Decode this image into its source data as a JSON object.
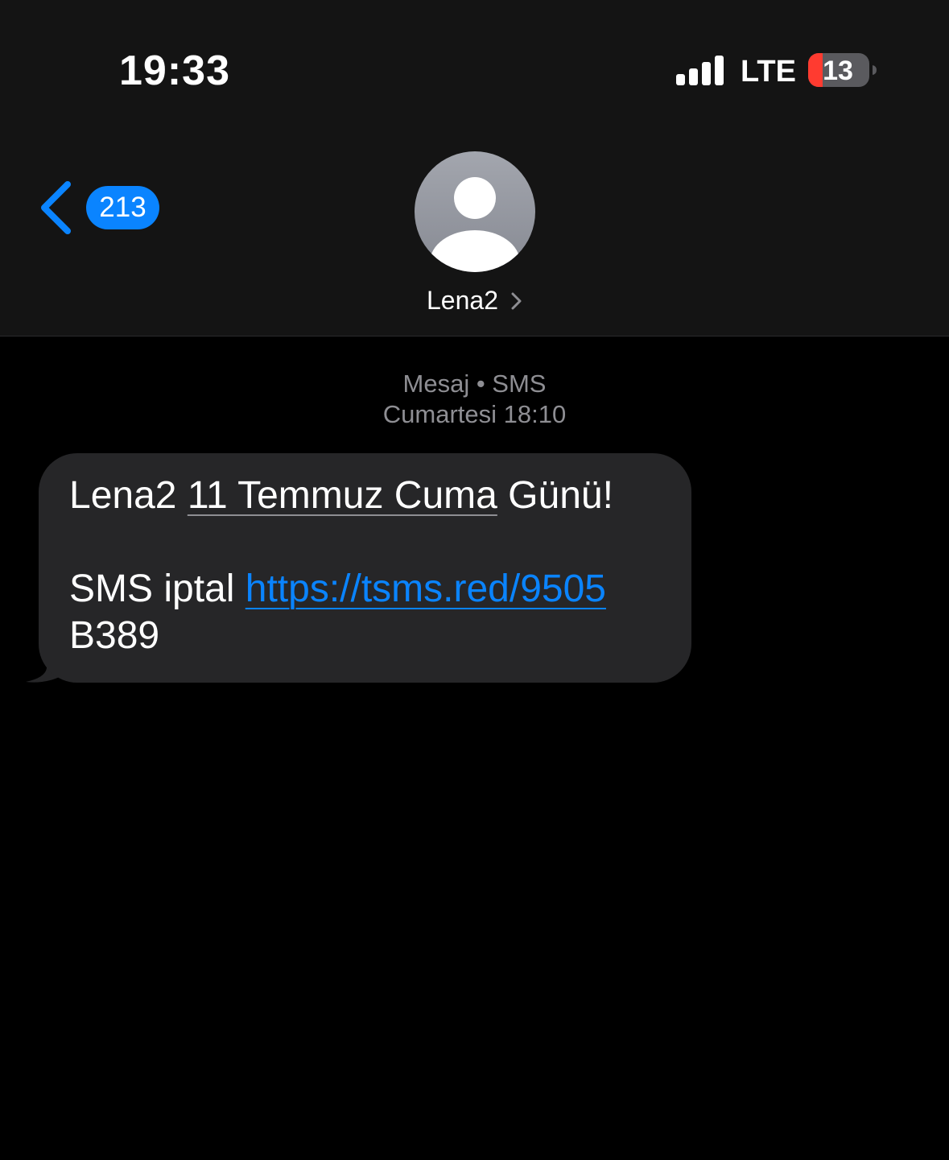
{
  "status_bar": {
    "time": "19:33",
    "network": "LTE",
    "battery_level": "13",
    "signal_bars": 4
  },
  "nav": {
    "back_count": "213",
    "contact_name": "Lena2"
  },
  "conversation": {
    "meta_service": "Mesaj • SMS",
    "meta_day": "Cumartesi",
    "meta_time": "18:10"
  },
  "message": {
    "line1_prefix": "Lena2 ",
    "line1_date": "11 Temmuz Cuma",
    "line1_suffix": " Günü!",
    "line2_prefix": "SMS iptal ",
    "link": "https://tsms.red/9505",
    "line3": "B389"
  },
  "colors": {
    "accent": "#0a84ff",
    "background": "#000000",
    "header_background": "#141414",
    "bubble": "#262628",
    "secondary_text": "#8e8e93",
    "battery_low": "#ff3b30"
  }
}
